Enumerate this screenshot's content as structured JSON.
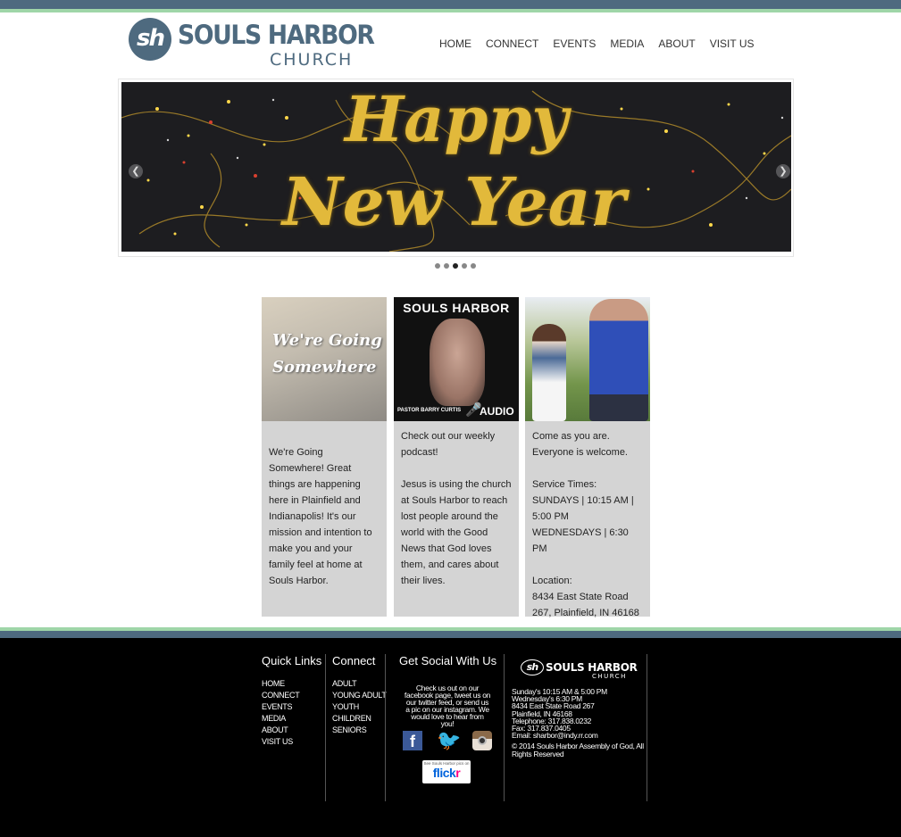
{
  "brand": {
    "logo_mark": "sh",
    "line1": "SOULS HARBOR",
    "line2": "CHURCH",
    "color": "#4e6a7f",
    "accent": "#9fd6a8"
  },
  "nav": {
    "items": [
      {
        "label": "HOME"
      },
      {
        "label": "CONNECT"
      },
      {
        "label": "EVENTS"
      },
      {
        "label": "MEDIA"
      },
      {
        "label": "ABOUT"
      },
      {
        "label": "VISIT US"
      }
    ]
  },
  "slider": {
    "heading_line1": "Happy",
    "heading_line2": "New Year",
    "prev_icon": "chevron-left-icon",
    "next_icon": "chevron-right-icon",
    "slide_count": 5,
    "active_slide": 3
  },
  "cards": [
    {
      "image_title_line1": "We're Going",
      "image_title_line2": "Somewhere",
      "paragraphs": [
        "We're Going Somewhere! Great things are happening here in Plainfield and Indianapolis! It's our mission and intention to make you and your family feel at home at Souls Harbor."
      ]
    },
    {
      "image_title": "SOULS HARBOR",
      "image_caption": "PASTOR BARRY CURTIS",
      "image_audio": "AUDIO",
      "paragraphs": [
        "Check out our weekly podcast!",
        "Jesus is using the church at Souls Harbor to reach lost people around the world with the Good News that God loves them, and cares about their lives."
      ]
    },
    {
      "paragraphs": [
        "Come as you are. Everyone is welcome.",
        "Service Times:",
        "SUNDAYS | 10:15 AM | 5:00 PM",
        "WEDNESDAYS | 6:30 PM",
        "Location:",
        "8434 East State Road 267, Plainfield, IN 46168"
      ]
    }
  ],
  "footer": {
    "quick_links": {
      "title": "Quick Links",
      "items": [
        "HOME",
        "CONNECT",
        "EVENTS",
        "MEDIA",
        "ABOUT",
        "VISIT US"
      ]
    },
    "connect": {
      "title": "Connect",
      "items": [
        "ADULT",
        "YOUNG ADULT",
        "YOUTH",
        "CHILDREN",
        "SENIORS"
      ]
    },
    "social": {
      "title": "Get Social With Us",
      "text": "Check us out on our facebook page, tweet us on our twitter feed, or send us a pic on our instagram. We would love to hear from you!",
      "facebook_letter": "f",
      "flickr_small": "See Souls Harbor pics on",
      "flickr_word_a": "flick",
      "flickr_word_b": "r"
    },
    "info": {
      "logo_mark": "sh",
      "logo_line1": "SOULS HARBOR",
      "logo_line2": "CHURCH",
      "lines": [
        "Sunday's 10:15 AM & 5:00 PM",
        "Wednesday's 6:30 PM",
        "8434 East State Road 267",
        "Plainfield, IN 46168",
        "Telephone: 317.838.0232",
        "Fax: 317.837.0405",
        "Email: sharbor@indy.rr.com"
      ],
      "copyright": "© 2014 Souls Harbor Assembly of God, All Rights Reserved"
    }
  }
}
